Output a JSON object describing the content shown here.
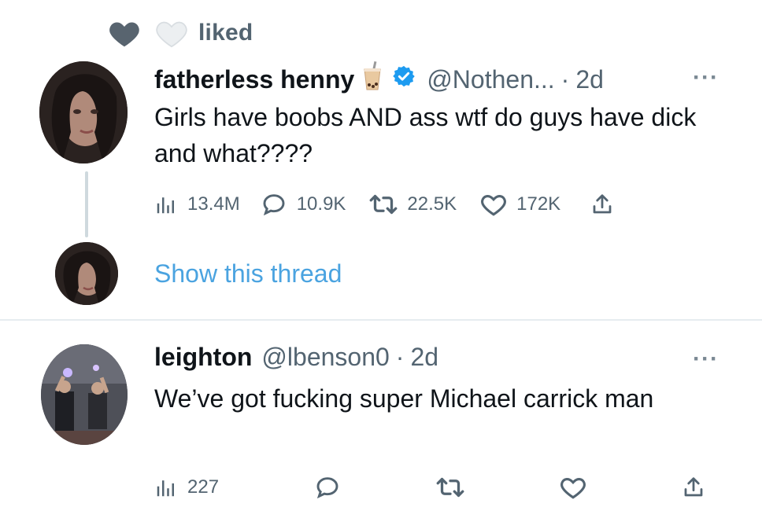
{
  "social_context": {
    "label": "liked"
  },
  "tweet1": {
    "name": "fatherless henny",
    "handle": "@Nothen...",
    "separator": "·",
    "time": "2d",
    "more": "···",
    "text": "Girls have boobs AND ass wtf do guys have dick and what????",
    "stats": {
      "views": "13.4M",
      "replies": "10.9K",
      "retweets": "22.5K",
      "likes": "172K"
    },
    "verified": true
  },
  "thread": {
    "show_label": "Show this thread"
  },
  "tweet2": {
    "name": "leighton",
    "handle": "@lbenson0",
    "separator": "·",
    "time": "2d",
    "more": "···",
    "text": "We’ve got fucking super Michael carrick man",
    "stats": {
      "views": "227"
    }
  },
  "colors": {
    "verified": "#1d9bf0",
    "link": "#4aa3e0",
    "secondary_text": "#536471"
  },
  "icons": [
    "heart-filled-icon",
    "heart-outline-icon",
    "bubble-tea-emoji-icon",
    "verified-badge-icon",
    "views-icon",
    "reply-icon",
    "retweet-icon",
    "like-icon",
    "share-icon",
    "more-icon"
  ]
}
